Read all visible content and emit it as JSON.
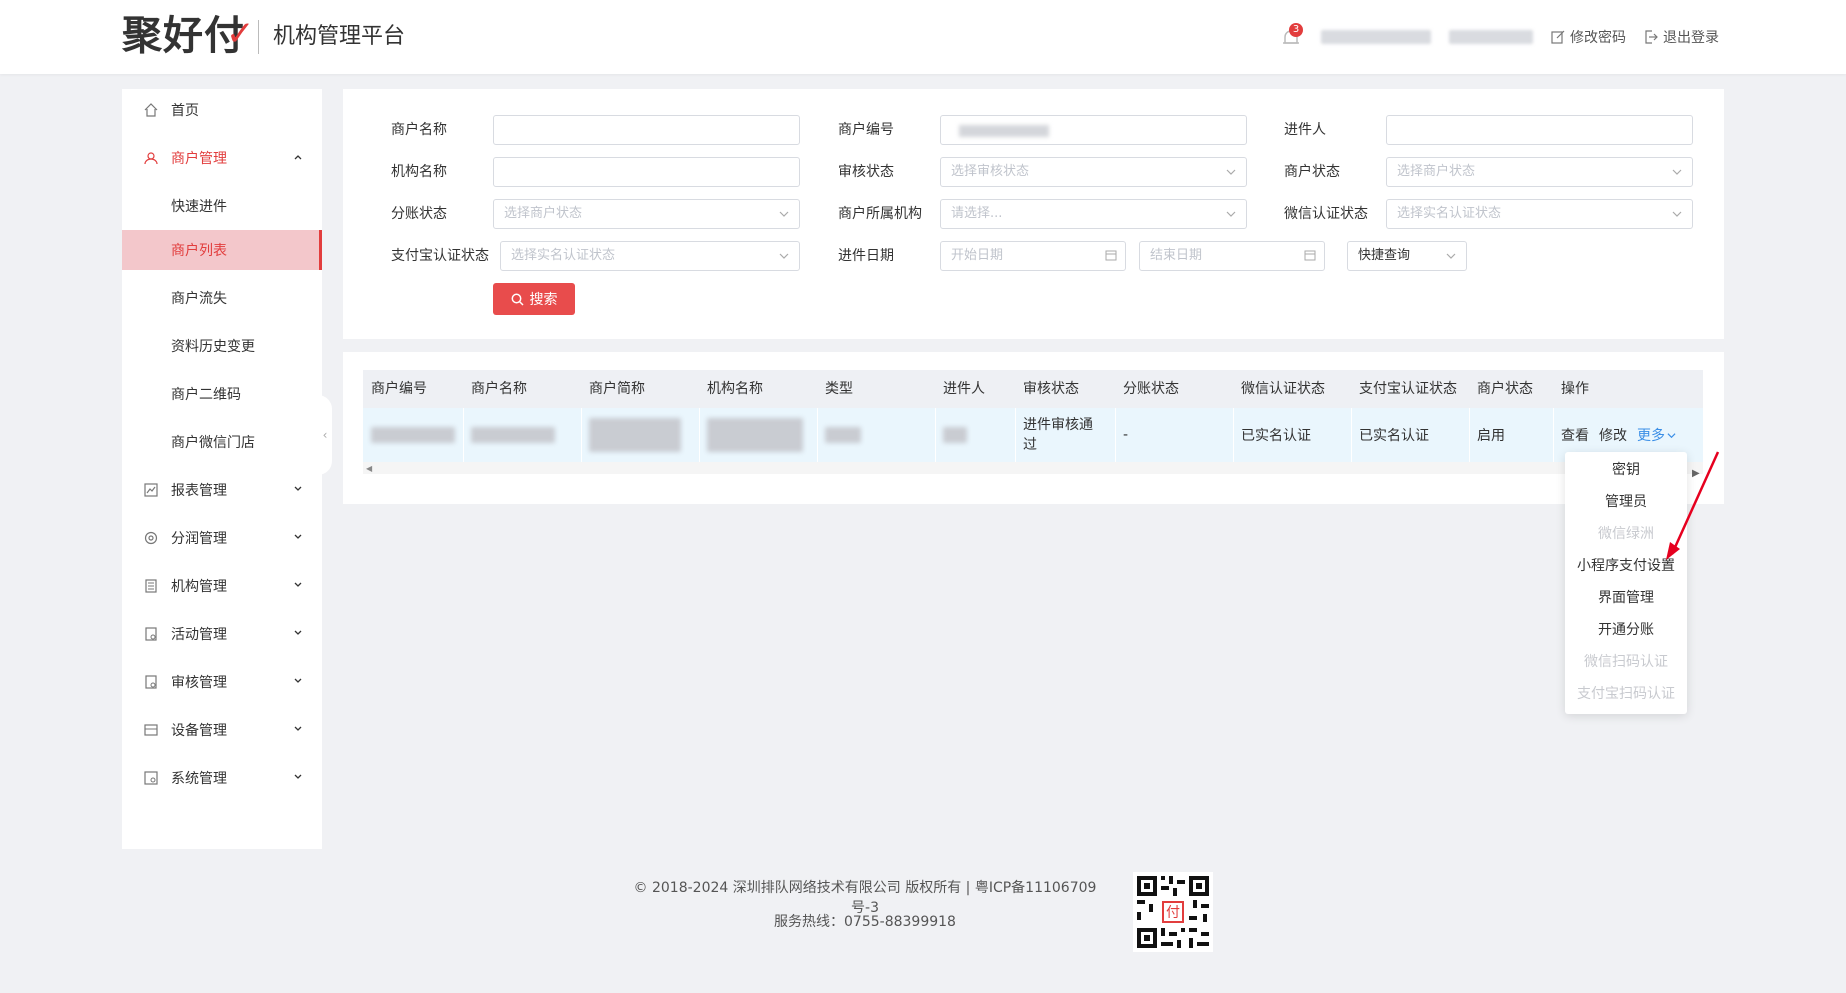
{
  "header": {
    "logo_main": "聚好付",
    "logo_check": "✓",
    "platform_title": "机构管理平台",
    "notification_count": "3",
    "change_password": "修改密码",
    "logout": "退出登录"
  },
  "sidebar": {
    "items": [
      {
        "label": "首页"
      },
      {
        "label": "商户管理"
      },
      {
        "label": "快速进件"
      },
      {
        "label": "商户列表"
      },
      {
        "label": "商户流失"
      },
      {
        "label": "资料历史变更"
      },
      {
        "label": "商户二维码"
      },
      {
        "label": "商户微信门店"
      },
      {
        "label": "报表管理"
      },
      {
        "label": "分润管理"
      },
      {
        "label": "机构管理"
      },
      {
        "label": "活动管理"
      },
      {
        "label": "审核管理"
      },
      {
        "label": "设备管理"
      },
      {
        "label": "系统管理"
      }
    ]
  },
  "search": {
    "merchant_name_label": "商户名称",
    "merchant_no_label": "商户编号",
    "applicant_label": "进件人",
    "org_name_label": "机构名称",
    "audit_status_label": "审核状态",
    "audit_status_placeholder": "选择审核状态",
    "merchant_status_label": "商户状态",
    "merchant_status_placeholder": "选择商户状态",
    "split_status_label": "分账状态",
    "split_status_placeholder": "选择商户状态",
    "merchant_org_label": "商户所属机构",
    "merchant_org_placeholder": "请选择...",
    "wechat_auth_label": "微信认证状态",
    "wechat_auth_placeholder": "选择实名认证状态",
    "alipay_auth_label": "支付宝认证状态",
    "alipay_auth_placeholder": "选择实名认证状态",
    "date_label": "进件日期",
    "start_date_placeholder": "开始日期",
    "end_date_placeholder": "结束日期",
    "quick_query": "快捷查询",
    "search_button": "搜索"
  },
  "table": {
    "headers": [
      "商户编号",
      "商户名称",
      "商户简称",
      "机构名称",
      "类型",
      "进件人",
      "审核状态",
      "分账状态",
      "微信认证状态",
      "支付宝认证状态",
      "商户状态",
      "操作"
    ],
    "row": {
      "audit_status": "进件审核通过",
      "split_status": "-",
      "wechat_auth": "已实名认证",
      "alipay_auth": "已实名认证",
      "merchant_status": "启用",
      "op_view": "查看",
      "op_edit": "修改",
      "op_more": "更多"
    }
  },
  "dropdown": {
    "items": [
      {
        "label": "密钥",
        "enabled": true
      },
      {
        "label": "管理员",
        "enabled": true
      },
      {
        "label": "微信绿洲",
        "enabled": false
      },
      {
        "label": "小程序支付设置",
        "enabled": true
      },
      {
        "label": "界面管理",
        "enabled": true
      },
      {
        "label": "开通分账",
        "enabled": true
      },
      {
        "label": "微信扫码认证",
        "enabled": false
      },
      {
        "label": "支付宝扫码认证",
        "enabled": false
      }
    ]
  },
  "footer": {
    "copyright": "© 2018-2024 深圳排队网络技术有限公司 版权所有 | 粤ICP备11106709号-3",
    "hotline": "服务热线：0755-88399918",
    "qr_center": "付"
  },
  "colors": {
    "accent": "#e23d3d",
    "link": "#3a8ee6",
    "active_bg": "#f3c7cb",
    "row_hover": "#eaf6fd"
  }
}
